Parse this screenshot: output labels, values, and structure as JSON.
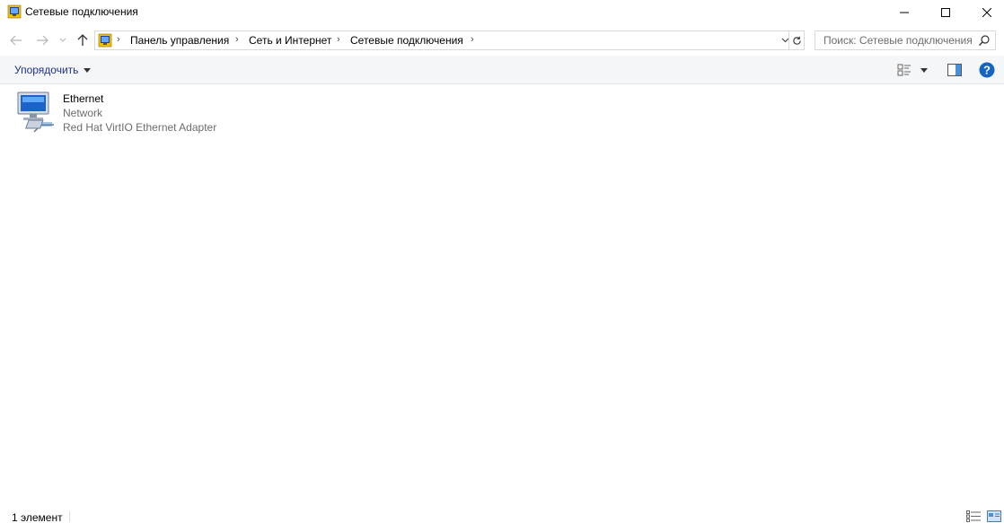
{
  "window": {
    "title": "Сетевые подключения",
    "icon": "network-connections-icon"
  },
  "address": {
    "breadcrumbs": [
      "Панель управления",
      "Сеть и Интернет",
      "Сетевые подключения"
    ]
  },
  "search": {
    "placeholder": "Поиск: Сетевые подключения"
  },
  "toolbar": {
    "organize_label": "Упорядочить"
  },
  "items": [
    {
      "name": "Ethernet",
      "network": "Network",
      "adapter": "Red Hat VirtIO Ethernet Adapter",
      "icon": "network-adapter-icon"
    }
  ],
  "status": {
    "count": "1 элемент"
  },
  "colors": {
    "command_bar_bg": "#f5f6f7",
    "link_blue": "#1e3287",
    "help_blue": "#1565c0"
  }
}
